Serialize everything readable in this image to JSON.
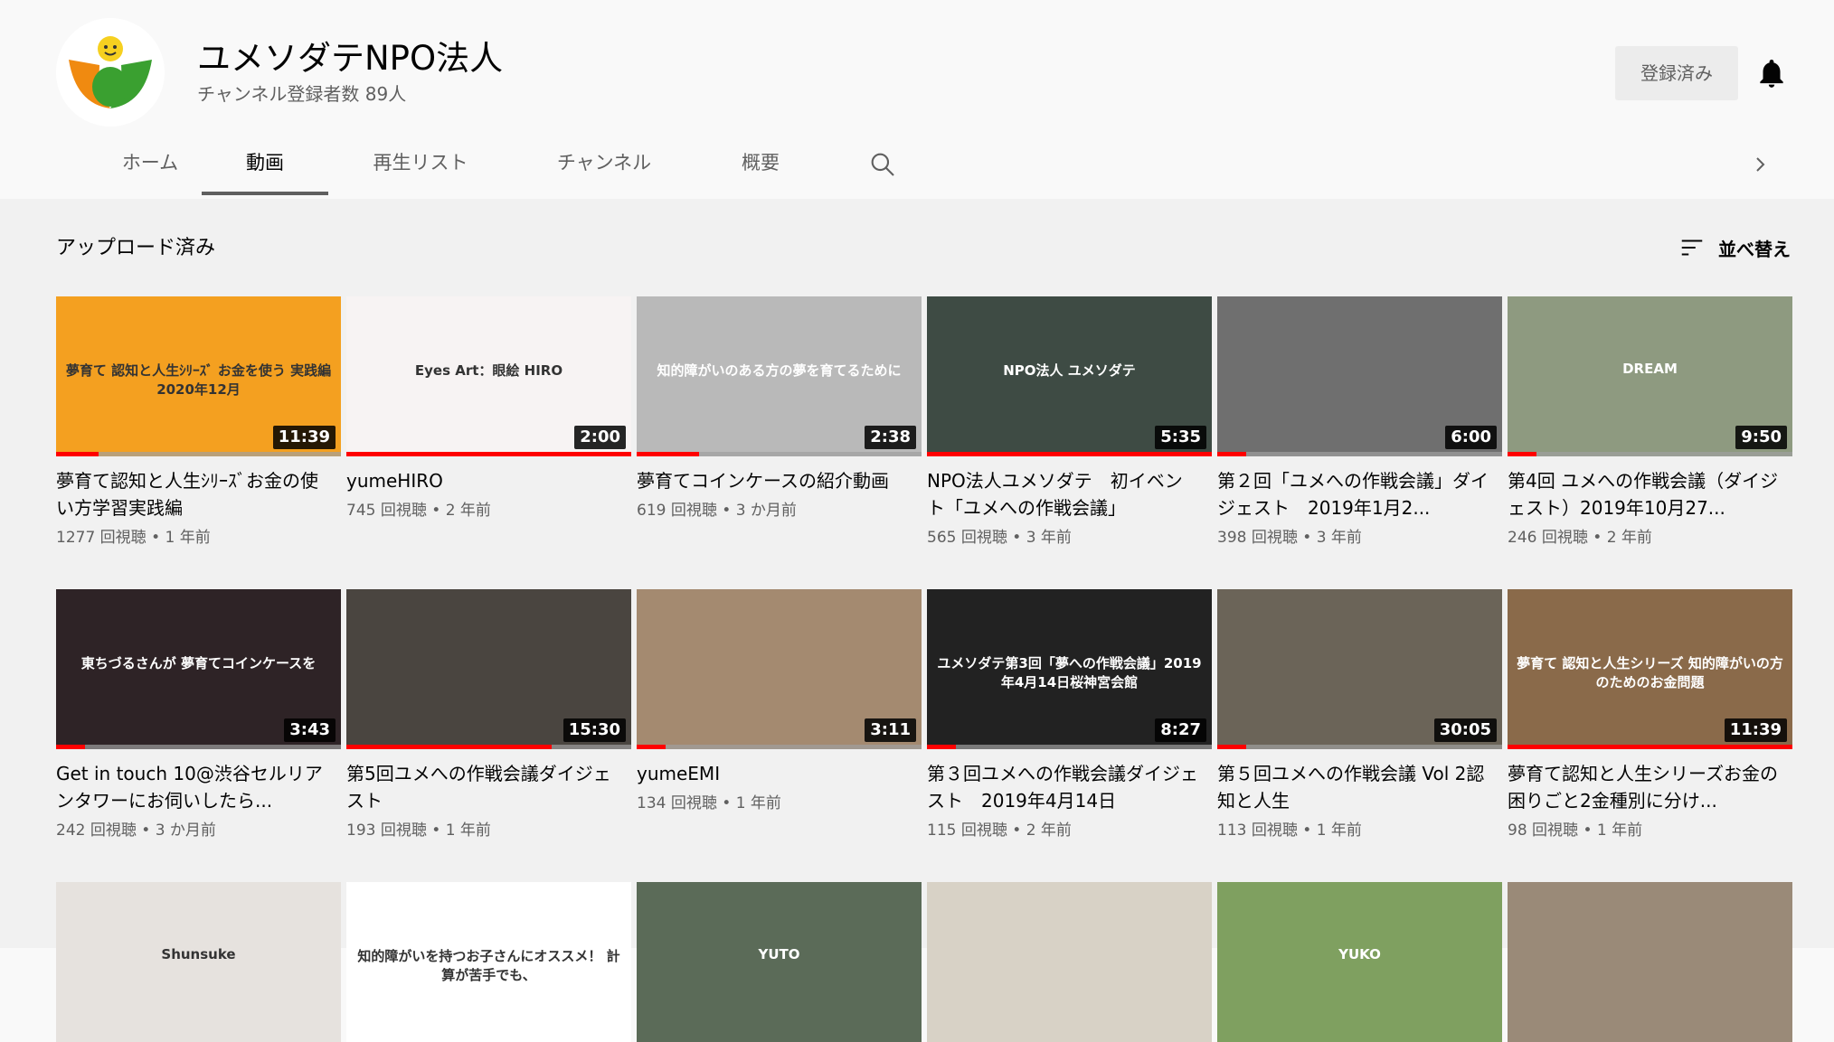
{
  "channel": {
    "name": "ユメソダテNPO法人",
    "subscribers": "チャンネル登録者数 89人",
    "subscribe_label": "登録済み"
  },
  "tabs": [
    "ホーム",
    "動画",
    "再生リスト",
    "チャンネル",
    "概要"
  ],
  "active_tab": "動画",
  "section": {
    "title": "アップロード済み",
    "sort_label": "並べ替え"
  },
  "icons": {
    "avatar": "npo-logo-icon",
    "bell": "bell-icon",
    "search": "search-icon",
    "next": "chevron-right-icon",
    "sort": "sort-icon"
  },
  "colors": {
    "progress": "#ff0000",
    "subscribed_btn": "#ececec"
  },
  "videos": [
    {
      "title": "夢育て認知と人生ｼﾘｰｽﾞお金の使い方学習実践編",
      "views": "1277 回視聴",
      "age": "1 年前",
      "duration": "11:39",
      "progress": 0.15,
      "thumb_text": "夢育て 認知と人生ｼﾘｰｽﾞ お金を使う 実践編 2020年12月",
      "bg": "#f4a020"
    },
    {
      "title": "yumeHIRO",
      "views": "745 回視聴",
      "age": "2 年前",
      "duration": "2:00",
      "progress": 1.0,
      "thumb_text": "Eyes Art：眼絵 HIRO",
      "bg": "#f7f3f3"
    },
    {
      "title": "夢育てコインケースの紹介動画",
      "views": "619 回視聴",
      "age": "3 か月前",
      "duration": "2:38",
      "progress": 0.22,
      "thumb_text": "知的障がいのある方の夢を育てるために",
      "bg": "#b9b9b9"
    },
    {
      "title": "NPO法人ユメソダテ　初イベント「ユメへの作戦会議」",
      "views": "565 回視聴",
      "age": "3 年前",
      "duration": "5:35",
      "progress": 1.0,
      "thumb_text": "NPO法人 ユメソダテ",
      "bg": "#3e4b44"
    },
    {
      "title": "第２回「ユメへの作戦会議」ダイジェスト　2019年1月2...",
      "views": "398 回視聴",
      "age": "3 年前",
      "duration": "6:00",
      "progress": 0.1,
      "thumb_text": "",
      "bg": "#6f6f6f"
    },
    {
      "title": "第4回 ユメへの作戦会議（ダイジェスト）2019年10月27...",
      "views": "246 回視聴",
      "age": "2 年前",
      "duration": "9:50",
      "progress": 0.1,
      "thumb_text": "DREAM",
      "bg": "#8e9a80"
    },
    {
      "title": "Get in touch 10@渋谷セルリアンタワーにお伺いしたら...",
      "views": "242 回視聴",
      "age": "3 か月前",
      "duration": "3:43",
      "progress": 0.1,
      "thumb_text": "東ちづるさんが 夢育てコインケースを",
      "bg": "#2e2326"
    },
    {
      "title": "第5回ユメへの作戦会議ダイジェスト",
      "views": "193 回視聴",
      "age": "1 年前",
      "duration": "15:30",
      "progress": 0.72,
      "thumb_text": "",
      "bg": "#4a4540"
    },
    {
      "title": "yumeEMI",
      "views": "134 回視聴",
      "age": "1 年前",
      "duration": "3:11",
      "progress": 0.1,
      "thumb_text": "",
      "bg": "#a48a70"
    },
    {
      "title": "第３回ユメへの作戦会議ダイジェスト　2019年4月14日",
      "views": "115 回視聴",
      "age": "2 年前",
      "duration": "8:27",
      "progress": 0.1,
      "thumb_text": "ユメソダテ第3回「夢への作戦会議」2019年4月14日桜神宮会館",
      "bg": "#222"
    },
    {
      "title": "第５回ユメへの作戦会議 Vol 2認知と人生",
      "views": "113 回視聴",
      "age": "1 年前",
      "duration": "30:05",
      "progress": 0.1,
      "thumb_text": "",
      "bg": "#6b6458"
    },
    {
      "title": "夢育て認知と人生シリーズお金の困りごと2金種別に分け...",
      "views": "98 回視聴",
      "age": "1 年前",
      "duration": "11:39",
      "progress": 1.0,
      "thumb_text": "夢育て 認知と人生シリーズ 知的障がいの方のためのお金問題",
      "bg": "#8a6a4a"
    },
    {
      "title": "",
      "views": "",
      "age": "",
      "duration": "",
      "progress": 0,
      "thumb_text": "Shunsuke",
      "bg": "#e6e2de"
    },
    {
      "title": "",
      "views": "",
      "age": "",
      "duration": "",
      "progress": 0,
      "thumb_text": "知的障がいを持つお子さんにオススメ！ 計算が苦手でも、",
      "bg": "#ffffff"
    },
    {
      "title": "",
      "views": "",
      "age": "",
      "duration": "",
      "progress": 0,
      "thumb_text": "YUTO",
      "bg": "#5b6b58"
    },
    {
      "title": "",
      "views": "",
      "age": "",
      "duration": "",
      "progress": 0,
      "thumb_text": "",
      "bg": "#d8d2c6"
    },
    {
      "title": "",
      "views": "",
      "age": "",
      "duration": "",
      "progress": 0,
      "thumb_text": "YUKO",
      "bg": "#7fa060"
    },
    {
      "title": "",
      "views": "",
      "age": "",
      "duration": "",
      "progress": 0,
      "thumb_text": "",
      "bg": "#9a8a78"
    }
  ]
}
